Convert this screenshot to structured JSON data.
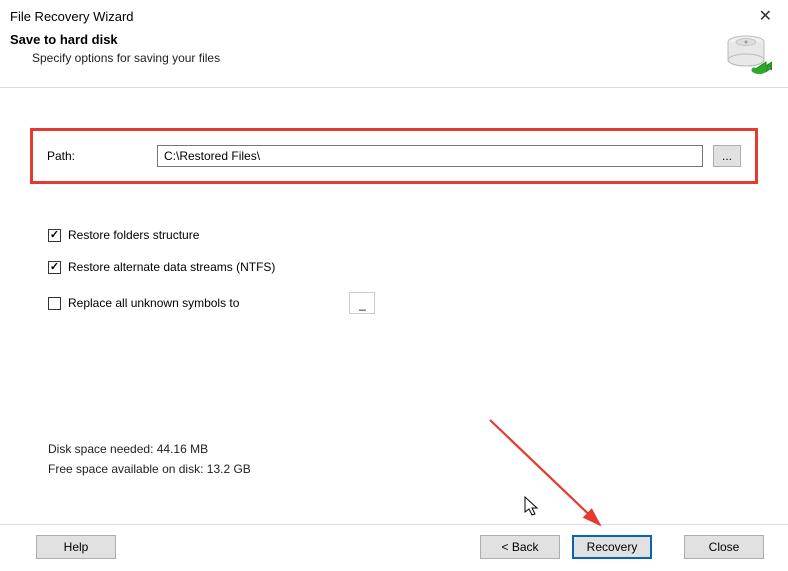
{
  "window": {
    "title": "File Recovery Wizard"
  },
  "header": {
    "title": "Save to hard disk",
    "subtitle": "Specify options for saving your files"
  },
  "path": {
    "label": "Path:",
    "value": "C:\\Restored Files\\",
    "browse": "..."
  },
  "options": {
    "restore_folders": {
      "label": "Restore folders structure",
      "checked": true
    },
    "restore_streams": {
      "label": "Restore alternate data streams (NTFS)",
      "checked": true
    },
    "replace_symbols": {
      "label": "Replace all unknown symbols to",
      "checked": false,
      "value": "_"
    }
  },
  "disk": {
    "needed_label": "Disk space needed:",
    "needed_value": "44.16 MB",
    "free_label": "Free space available on disk:",
    "free_value": "13.2 GB"
  },
  "buttons": {
    "help": "Help",
    "back": "< Back",
    "recovery": "Recovery",
    "close": "Close"
  }
}
